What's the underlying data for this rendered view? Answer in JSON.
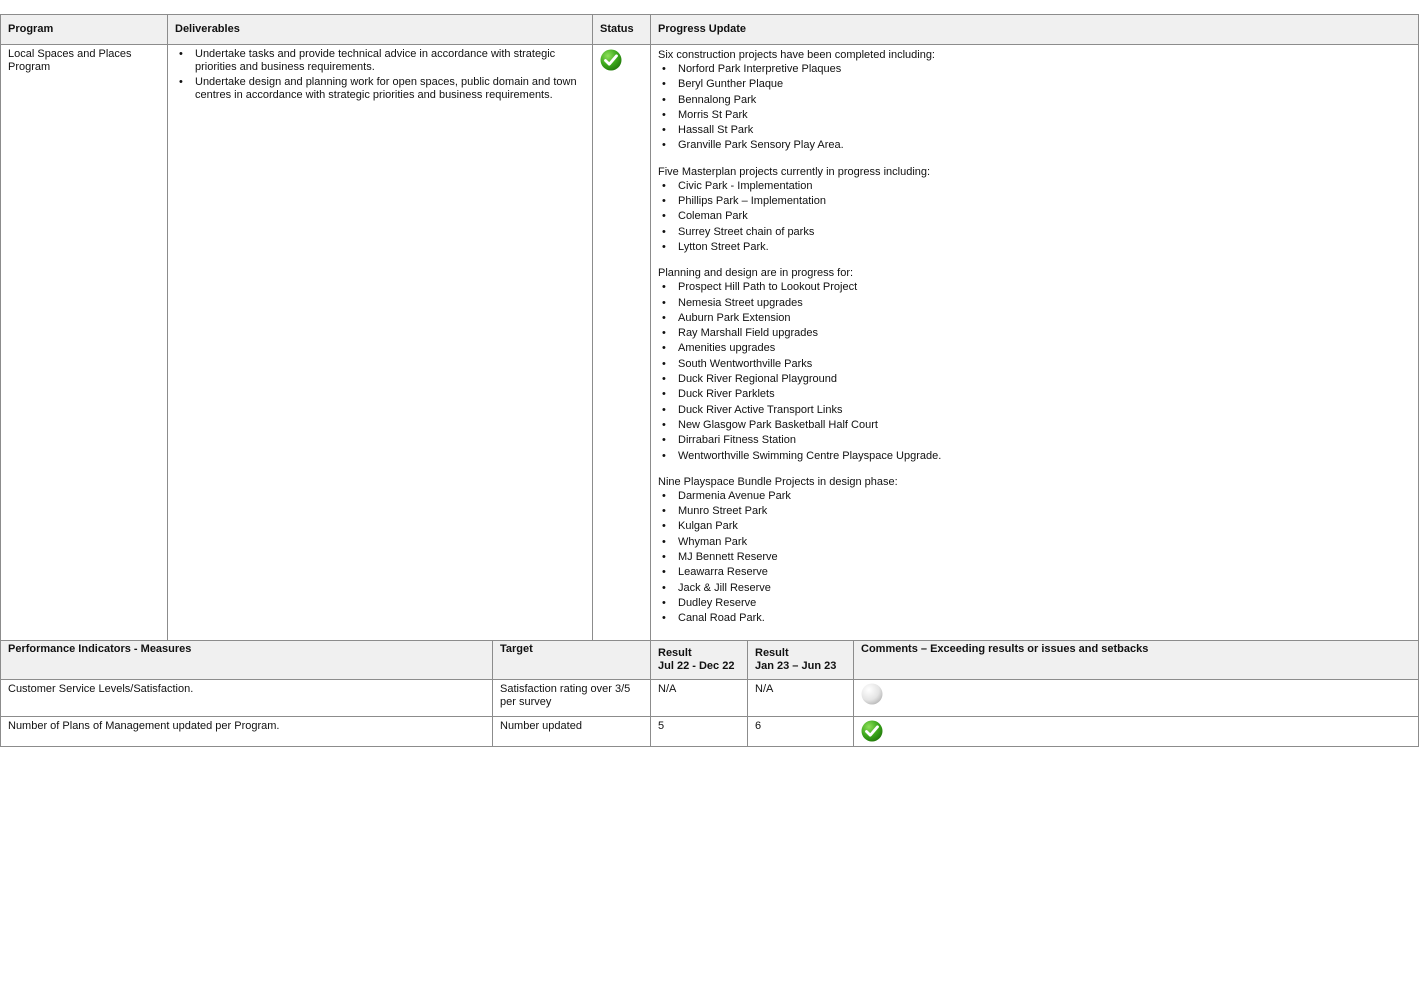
{
  "main_table": {
    "headers": {
      "program": "Program",
      "deliverables": "Deliverables",
      "status": "Status",
      "progress_update": "Progress Update"
    },
    "row": {
      "program": "Local Spaces and Places Program",
      "deliverables": [
        "Undertake tasks and provide technical advice in accordance with strategic priorities and business requirements.",
        "Undertake design and planning work for open spaces, public domain and town  centres in accordance with strategic priorities and business requirements."
      ],
      "status_icon": "green-check-icon",
      "progress_sections": [
        {
          "intro": "Six construction projects have been completed including:",
          "items": [
            "Norford Park Interpretive Plaques",
            "Beryl Gunther Plaque",
            "Bennalong Park",
            "Morris St Park",
            "Hassall St Park",
            "Granville Park Sensory Play Area."
          ]
        },
        {
          "intro": "Five Masterplan projects currently in progress including:",
          "items": [
            "Civic Park - Implementation",
            "Phillips Park – Implementation",
            "Coleman Park",
            "Surrey Street chain of parks",
            "Lytton Street Park."
          ]
        },
        {
          "intro": "Planning and design are in progress for:",
          "items": [
            "Prospect Hill Path to Lookout Project",
            "Nemesia Street upgrades",
            "Auburn Park Extension",
            "Ray Marshall Field upgrades",
            "Amenities upgrades",
            "South Wentworthville Parks",
            "Duck River Regional Playground",
            "Duck River Parklets",
            "Duck River Active Transport Links",
            "New Glasgow Park Basketball Half Court",
            "Dirrabari Fitness Station",
            "Wentworthville Swimming Centre Playspace Upgrade."
          ]
        },
        {
          "intro": "Nine Playspace Bundle Projects in design phase:",
          "items": [
            "Darmenia Avenue Park",
            "Munro Street Park",
            "Kulgan Park",
            "Whyman Park",
            "MJ Bennett Reserve",
            "Leawarra Reserve",
            "Jack & Jill Reserve",
            "Dudley Reserve",
            "Canal Road Park."
          ]
        }
      ]
    }
  },
  "perf_table": {
    "headers": {
      "measures": "Performance Indicators - Measures",
      "target": "Target",
      "result_1_line1": "Result",
      "result_1_line2": "Jul 22 - Dec 22",
      "result_2_line1": "Result",
      "result_2_line2": "Jan 23 – Jun 23",
      "comments": "Comments – Exceeding results or issues and setbacks"
    },
    "rows": [
      {
        "measure": "Customer Service Levels/Satisfaction.",
        "target": "Satisfaction rating over 3/5 per survey",
        "result_1": "N/A",
        "result_2": "N/A",
        "comment_icon": "grey-circle-icon"
      },
      {
        "measure": "Number of Plans of Management updated per Program.",
        "target": "Number updated",
        "result_1": "5",
        "result_2": "6",
        "comment_icon": "green-check-icon"
      }
    ]
  },
  "colors": {
    "header_bg": "#f0f0f0",
    "border": "#8c8c8c",
    "status_green": "#3aa61a",
    "neutral_grey": "#d9d9d9"
  }
}
